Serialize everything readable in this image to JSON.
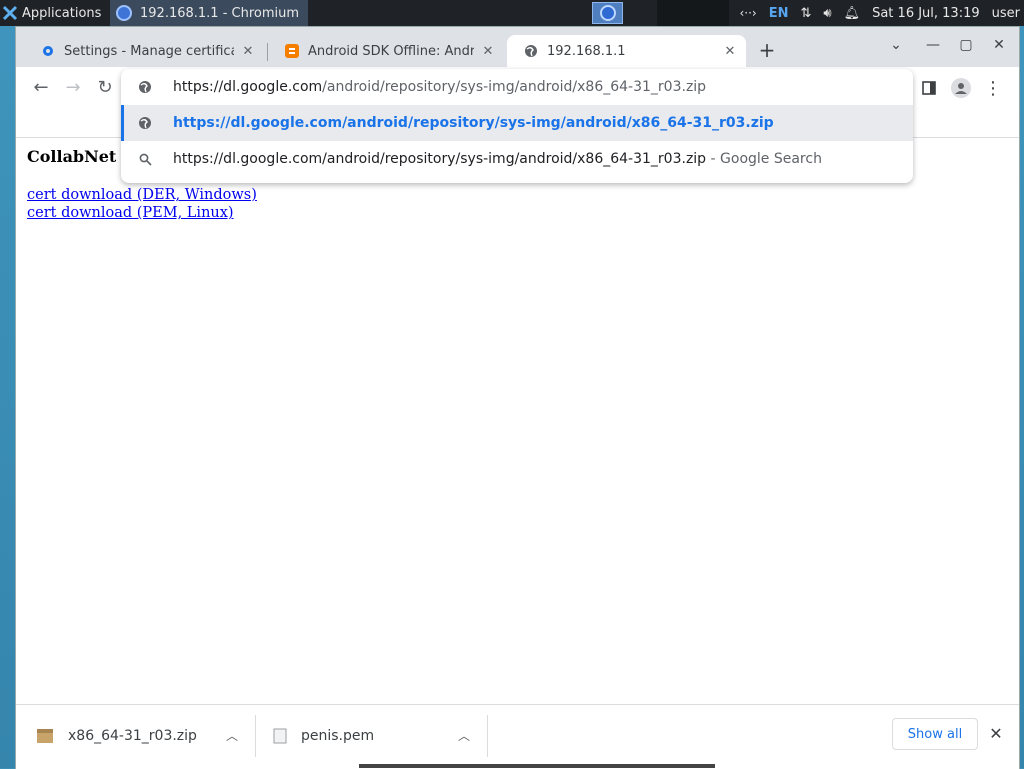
{
  "panel": {
    "apps_label": "Applications",
    "task_label": "192.168.1.1 - Chromium",
    "lang": "EN",
    "clock": "Sat 16 Jul, 13:19",
    "user": "user"
  },
  "tabs": [
    {
      "title": "Settings - Manage certificates",
      "icon": "gear-icon"
    },
    {
      "title": "Android SDK Offline: Android",
      "icon": "blogger-icon"
    },
    {
      "title": "192.168.1.1",
      "icon": "globe-icon",
      "active": true
    }
  ],
  "omnibox": {
    "input": {
      "host": "https://dl.google.com",
      "path": "/android/repository/sys-img/android/x86_64-31_r03.zip"
    },
    "suggestions": [
      {
        "text": "https://dl.google.com/android/repository/sys-img/android/x86_64-31_r03.zip",
        "icon": "globe-icon",
        "selected": true
      },
      {
        "text": "https://dl.google.com/android/repository/sys-img/android/x86_64-31_r03.zip",
        "suffix": " - Google Search",
        "icon": "search-icon"
      }
    ]
  },
  "page": {
    "heading": "CollabNet C",
    "links": [
      "cert download (DER, Windows)",
      "cert download (PEM, Linux)"
    ]
  },
  "downloads": {
    "items": [
      {
        "name": "x86_64-31_r03.zip",
        "icon": "archive-icon"
      },
      {
        "name": "penis.pem",
        "icon": "file-icon"
      }
    ],
    "show_all": "Show all"
  },
  "colors": {
    "accent": "#1a73e8",
    "link": "#0000ee",
    "panel": "#1f2226"
  }
}
